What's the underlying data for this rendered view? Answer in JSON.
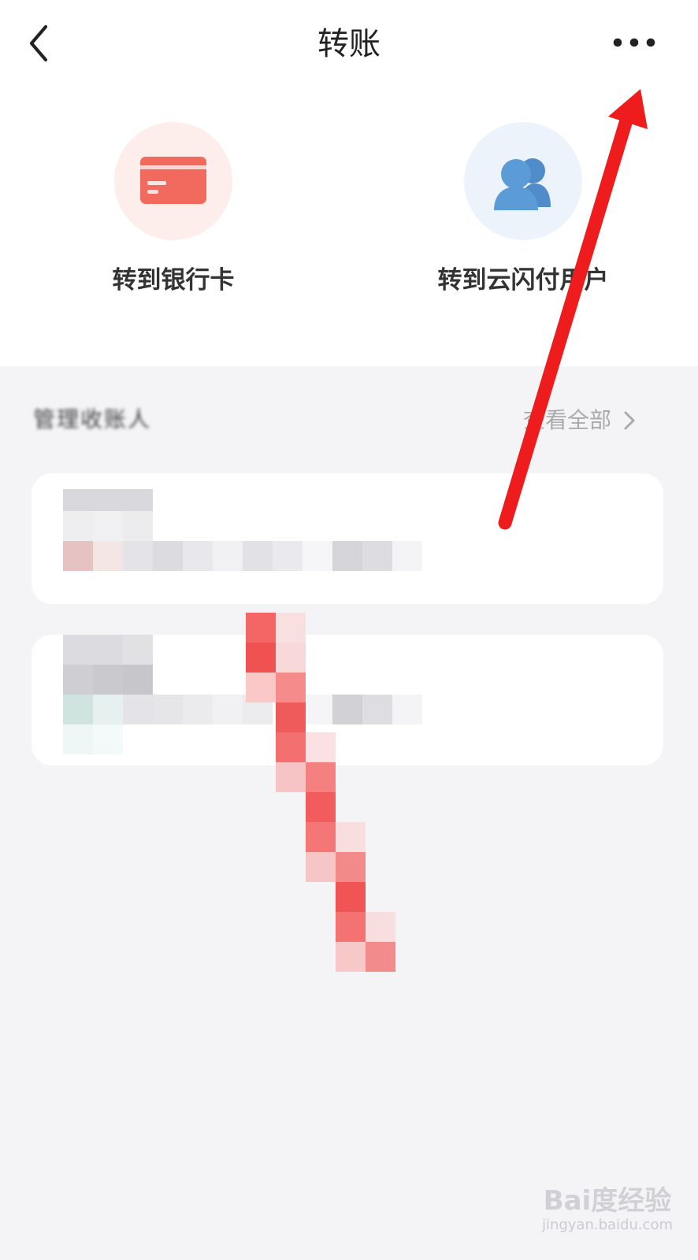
{
  "nav": {
    "title": "转账"
  },
  "actions": [
    {
      "label": "转到银行卡",
      "icon": "bank-card-icon"
    },
    {
      "label": "转到云闪付用户",
      "icon": "users-icon"
    }
  ],
  "recent": {
    "title": "管理收账人",
    "view_all": "查看全部"
  },
  "watermark": {
    "main": "Bai度经验",
    "sub": "jingyan.baidu.com"
  },
  "colors": {
    "accent_red": "#f26a5d",
    "accent_blue": "#5b9bd6",
    "arrow": "#ee1c1c"
  }
}
